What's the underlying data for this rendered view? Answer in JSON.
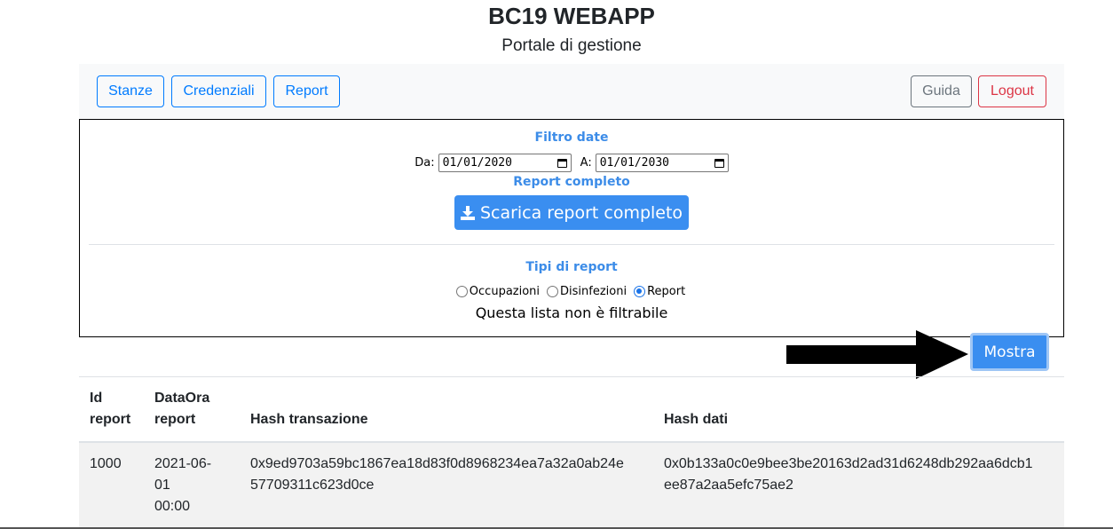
{
  "header": {
    "title": "BC19 WEBAPP",
    "subtitle": "Portale di gestione"
  },
  "navbar": {
    "stanze": "Stanze",
    "credenziali": "Credenziali",
    "report": "Report",
    "guida": "Guida",
    "logout": "Logout"
  },
  "filter": {
    "heading": "Filtro date",
    "from_label": "Da:",
    "from_value": "01/01/2020",
    "to_label": "A:",
    "to_value": "01/01/2030"
  },
  "full_report": {
    "heading": "Report completo",
    "button_label": "Scarica report completo"
  },
  "report_types": {
    "heading": "Tipi di report",
    "options": [
      {
        "label": "Occupazioni",
        "checked": false
      },
      {
        "label": "Disinfezioni",
        "checked": false
      },
      {
        "label": "Report",
        "checked": true
      }
    ],
    "note": "Questa lista non è filtrabile"
  },
  "show_button": "Mostra",
  "table": {
    "headers": {
      "id_line1": "Id",
      "id_line2": "report",
      "date_line1": "DataOra",
      "date_line2": "report",
      "hash_tx": "Hash transazione",
      "hash_data": "Hash dati"
    },
    "rows": [
      {
        "id": "1000",
        "date_line1": "2021-06-",
        "date_line2": "01",
        "date_line3": "00:00",
        "hash_tx_line1": "0x9ed9703a59bc1867ea18d83f0d8968234ea7a32a0ab24e",
        "hash_tx_line2": "57709311c623d0ce",
        "hash_data_line1": "0x0b133a0c0e9bee3be20163d2ad31d6248db292aa6dcb1",
        "hash_data_line2": "ee87a2aa5efc75ae2"
      }
    ]
  },
  "colors": {
    "primary": "#007bff",
    "accent_blue": "#3a8ef0",
    "danger": "#dc3545",
    "secondary": "#6c757d"
  }
}
